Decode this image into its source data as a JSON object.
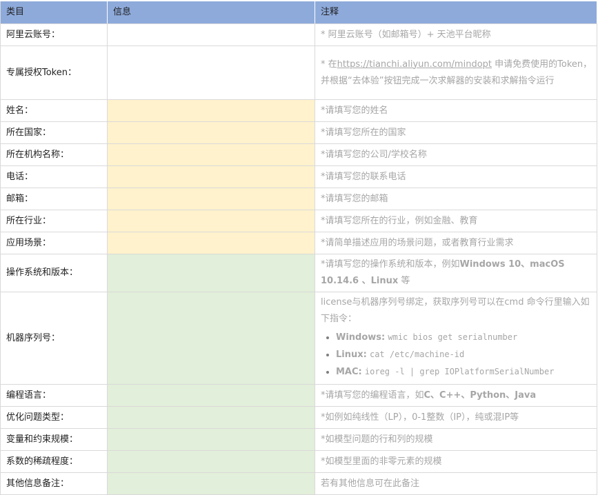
{
  "header": {
    "col_category": "类目",
    "col_info": "信息",
    "col_note": "注释"
  },
  "rows": {
    "aliyun": {
      "label": "阿里云账号：",
      "note": "* 阿里云账号（如邮箱号）+ 天池平台昵称"
    },
    "token": {
      "label": "专属授权Token：",
      "note_prefix": "* 在",
      "note_link": "https://tianchi.aliyun.com/mindopt",
      "note_suffix": " 申请免费使用的Token，并根据“去体验”按钮完成一次求解器的安装和求解指令运行"
    },
    "name": {
      "label": "姓名：",
      "note": "*请填写您的姓名"
    },
    "country": {
      "label": "所在国家：",
      "note": "*请填写您所在的国家"
    },
    "org": {
      "label": "所在机构名称：",
      "note": "*请填写您的公司/学校名称"
    },
    "phone": {
      "label": "电话：",
      "note": "*请填写您的联系电话"
    },
    "email": {
      "label": "邮箱：",
      "note": "*请填写您的邮箱"
    },
    "industry": {
      "label": "所在行业：",
      "note": "*请填写您所在的行业，例如金融、教育"
    },
    "scenario": {
      "label": "应用场景：",
      "note": "*请简单描述应用的场景问题，或者教育行业需求"
    },
    "os": {
      "label": "操作系统和版本：",
      "note_prefix": "*请填写您的操作系统和版本，例如",
      "note_bold": "Windows 10、macOS 10.14.6 、Linux",
      "note_suffix": " 等"
    },
    "machine": {
      "label": "机器序列号：",
      "note": "license与机器序列号绑定，获取序列号可以在cmd 命令行里输入如下指令：",
      "commands": [
        {
          "os": "Windows:",
          "cmd": "wmic bios get serialnumber"
        },
        {
          "os": "Linux:",
          "cmd": "cat /etc/machine-id"
        },
        {
          "os": "MAC:",
          "cmd": "ioreg -l | grep IOPlatformSerialNumber"
        }
      ]
    },
    "language": {
      "label": "编程语言：",
      "note_prefix": "*请填写您的编程语言，如",
      "note_bold": "C、C++、Python、Java",
      "note_suffix": ""
    },
    "problem": {
      "label": "优化问题类型：",
      "note": "*如例如纯线性（LP），0-1整数（IP），纯或混IP等"
    },
    "scale": {
      "label": "变量和约束规模：",
      "note": "*如模型问题的行和列的规模"
    },
    "sparsity": {
      "label": "系数的稀疏程度：",
      "note": "*如模型里面的非零元素的规模"
    },
    "other": {
      "label": "其他信息备注：",
      "note": "若有其他信息可在此备注"
    }
  },
  "colors": {
    "header_bg": "#8eaadb",
    "yellow_fill": "#fff2cc",
    "green_fill": "#e2efda",
    "note_text": "#a6a6a6"
  }
}
